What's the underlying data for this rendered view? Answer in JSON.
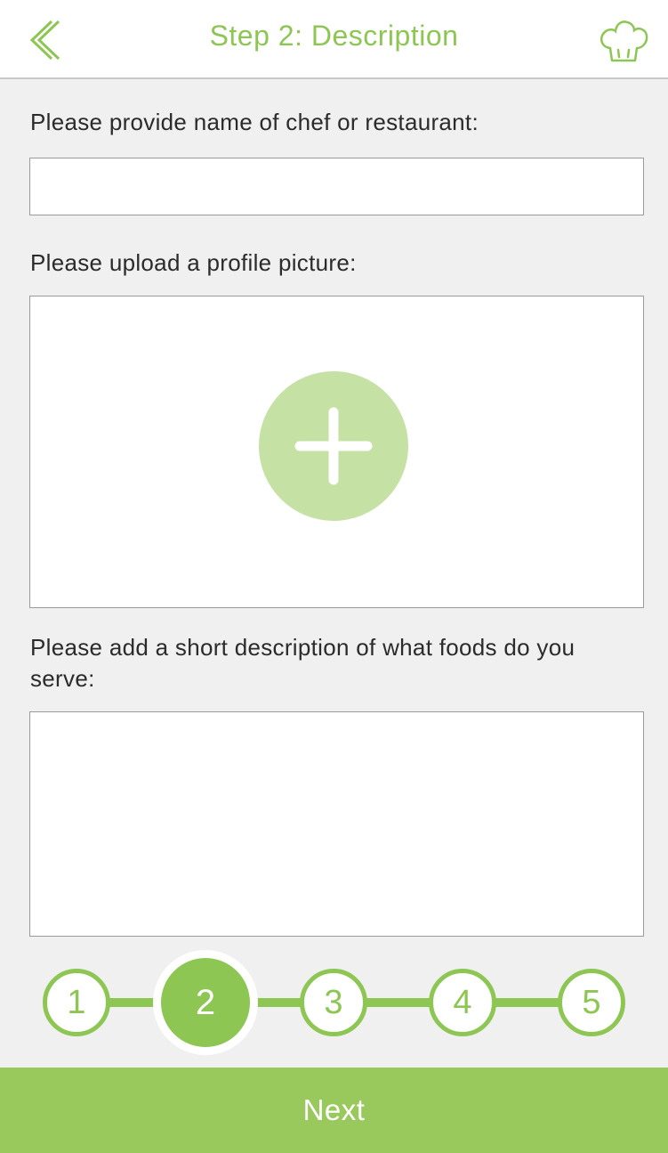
{
  "header": {
    "title": "Step 2: Description",
    "back_icon": "chevron-left-icon",
    "chef_icon": "chef-hat-icon"
  },
  "form": {
    "name_label": "Please provide name of chef or restaurant:",
    "name_value": "",
    "picture_label": "Please upload a profile picture:",
    "upload_icon": "plus-icon",
    "description_label": "Please add a short description of what foods do you serve:",
    "description_value": ""
  },
  "stepper": {
    "current": 2,
    "steps": [
      {
        "label": "1"
      },
      {
        "label": "2"
      },
      {
        "label": "3"
      },
      {
        "label": "4"
      },
      {
        "label": "5"
      }
    ]
  },
  "footer": {
    "next_label": "Next"
  },
  "colors": {
    "accent": "#8dc653",
    "accent_light": "#c5e1a4",
    "button": "#99c95c",
    "background": "#f0f0f1"
  }
}
